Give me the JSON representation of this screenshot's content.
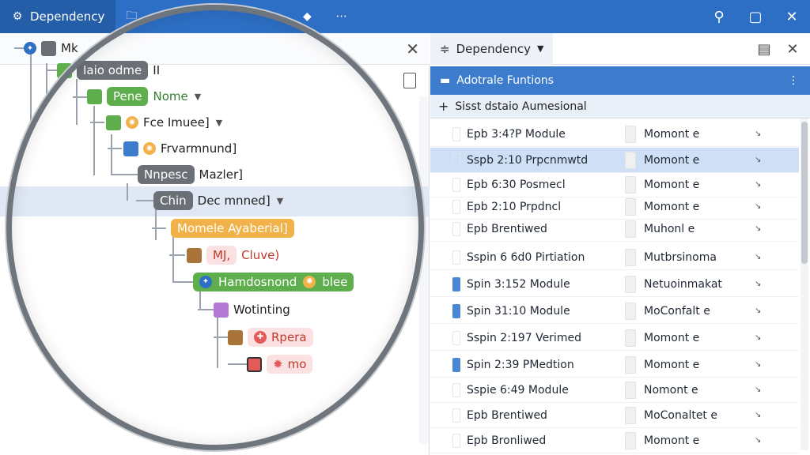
{
  "titlebar": {
    "tab_label": "Dependency",
    "more_label": "···"
  },
  "tree": {
    "root_label": "Mk",
    "nodes": [
      {
        "label": "Iaio odme",
        "extra": "II"
      },
      {
        "label": "Pene",
        "extra": "Nome"
      },
      {
        "label": "Fce Imuee]"
      },
      {
        "label": "Frvarmnund]"
      },
      {
        "label": "Nnpesc",
        "extra": "Mazler]"
      },
      {
        "label": "Chin",
        "extra": "Dec mnned]"
      },
      {
        "label": "Momele Ayaberial]"
      },
      {
        "label": "MJ,",
        "extra": "Cluve)"
      },
      {
        "label": "Hamdosnond",
        "extra": "blee"
      },
      {
        "label": "Wotinting"
      },
      {
        "label": "Rpera"
      },
      {
        "label": "mo"
      }
    ]
  },
  "right": {
    "tab_label": "Dependency",
    "section_title": "Adotrale Funtions",
    "sub_title": "Sisst dstaio Aumesional",
    "rows": [
      {
        "name": "Epb 3:4?P Module",
        "value": "Momont e",
        "icon": false,
        "selected": false
      },
      {
        "name": "Sspb 2:10 Prpcnmwtd",
        "value": "Momont e",
        "icon": false,
        "selected": true
      },
      {
        "name": "Epb 6:30 Posmecl",
        "value": "Momont e",
        "icon": false,
        "selected": false
      },
      {
        "name": "Epb 2:10 Prpdncl",
        "value": "Momont e",
        "icon": false,
        "selected": false
      },
      {
        "name": "Epb Brentiwed",
        "value": "Muhonl e",
        "icon": false,
        "selected": false
      },
      {
        "name": "Sspin 6 6d0 Pirtiation",
        "value": "Mutbrsinoma",
        "icon": false,
        "selected": false
      },
      {
        "name": "Spin 3:152 Module",
        "value": "Netuoinmakat",
        "icon": true,
        "selected": false
      },
      {
        "name": "Spin 31:10 Module",
        "value": "MoConfalt e",
        "icon": true,
        "selected": false
      },
      {
        "name": "Sspin 2:197 Verimed",
        "value": "Momont e",
        "icon": false,
        "selected": false
      },
      {
        "name": "Spin 2:39 PMedtion",
        "value": "Momont e",
        "icon": true,
        "selected": false
      },
      {
        "name": "Sspie 6:49 Module",
        "value": "Nomont e",
        "icon": false,
        "selected": false
      },
      {
        "name": "Epb Brentiwed",
        "value": "MoConaltet e",
        "icon": false,
        "selected": false
      },
      {
        "name": "Epb Bronliwed",
        "value": "Momont e",
        "icon": false,
        "selected": false
      }
    ]
  },
  "colors": {
    "titlebar": "#2d6fc4",
    "section": "#3d7ccc",
    "selected_row": "#cfe0f6",
    "green": "#5fae4e",
    "orange": "#f2b24a",
    "purple": "#b178d4",
    "red": "#e25a5a",
    "gray": "#6b6f76"
  }
}
